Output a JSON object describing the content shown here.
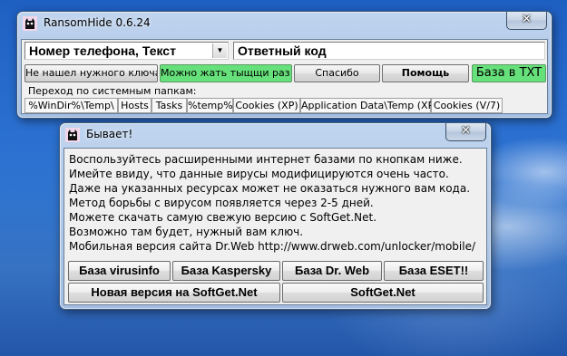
{
  "main_window": {
    "title": "RansomHide 0.6.24",
    "close_symbol": "✕",
    "icon": "ransomhide-cat-icon",
    "phone_field_value": "Номер телефона, Текст",
    "reply_code_value": "Ответный код",
    "buttons": {
      "not_found": "Не нашел нужного ключа",
      "click_many": "Можно жать тыщщи раз!",
      "thanks": "Спасибо",
      "help": "Помощь",
      "db_txt": "База в TXT"
    },
    "folders_label": "Переход по системным папкам:",
    "folder_tabs": [
      "%WinDir%\\Temp\\",
      "Hosts",
      "Tasks",
      "%temp%",
      "Cookies (XP)",
      "Application Data\\Temp (XP)",
      "Cookies (V/7)"
    ]
  },
  "dialog": {
    "title": "Бывает!",
    "close_symbol": "✕",
    "icon": "ransomhide-cat-icon",
    "lines": [
      "Воспользуйтесь расширенными интернет базами по кнопкам ниже.",
      "Имейте ввиду, что данные вирусы модифицируются очень часто.",
      "Даже на указанных ресурсах может не оказаться нужного вам кода.",
      "Метод борьбы с вирусом появляется через 2-5 дней.",
      "Можете скачать самую свежую версию с SoftGet.Net.",
      "Возможно там будет, нужный вам ключ.",
      "Мобильная версия сайта Dr.Web http://www.drweb.com/unlocker/mobile/"
    ],
    "buttons": {
      "virusinfo": "База virusinfo",
      "kaspersky": "База Kaspersky",
      "drweb": "База Dr. Web",
      "eset": "База ESET!!",
      "new_version": "Новая версия на SoftGet.Net",
      "softget": "SoftGet.Net"
    }
  },
  "colors": {
    "accent_green": "#66e07a",
    "desktop_blue": "#2a6fd0"
  }
}
